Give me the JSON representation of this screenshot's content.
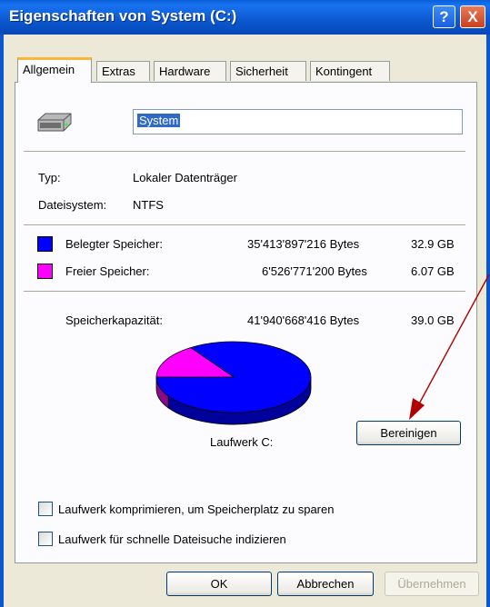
{
  "window": {
    "title": "Eigenschaften von System (C:)"
  },
  "title_buttons": {
    "help": "?",
    "close": "X"
  },
  "tabs": [
    "Allgemein",
    "Extras",
    "Hardware",
    "Sicherheit",
    "Kontingent"
  ],
  "drive": {
    "name_value": "System"
  },
  "info": {
    "type_label": "Typ:",
    "type_value": "Lokaler Datenträger",
    "fs_label": "Dateisystem:",
    "fs_value": "NTFS"
  },
  "space": {
    "used_label": "Belegter Speicher:",
    "used_bytes": "35'413'897'216 Bytes",
    "used_gb": "32.9 GB",
    "free_label": "Freier Speicher:",
    "free_bytes": "6'526'771'200 Bytes",
    "free_gb": "6.07 GB",
    "capacity_label": "Speicherkapazität:",
    "capacity_bytes": "41'940'668'416 Bytes",
    "capacity_gb": "39.0 GB"
  },
  "colors": {
    "used": "#0000ff",
    "free": "#ff00ff",
    "annotation_arrow": "#b00000"
  },
  "pie": {
    "drive_label": "Laufwerk C:",
    "used_fraction": 0.844,
    "free_fraction": 0.156
  },
  "buttons": {
    "cleanup": "Bereinigen",
    "ok": "OK",
    "cancel": "Abbrechen",
    "apply": "Übernehmen"
  },
  "options": {
    "compress": "Laufwerk komprimieren, um Speicherplatz zu sparen",
    "index": "Laufwerk für schnelle Dateisuche indizieren"
  }
}
